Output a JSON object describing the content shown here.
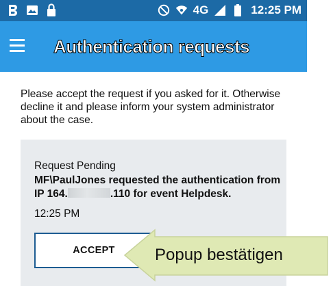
{
  "status_bar": {
    "network_label": "4G",
    "time": "12:25 PM"
  },
  "app_bar": {
    "title": "Authentication requests"
  },
  "intro_text": "Please accept the request if you asked for it. Otherwise decline it and please inform your system administrator about the case.",
  "request_card": {
    "title": "Request Pending",
    "message_before_ip": "MF\\PaulJones requested the authentication from IP 164.",
    "message_after_ip": ".110 for event Helpdesk.",
    "time": "12:25 PM",
    "accept_label": "ACCEPT"
  },
  "callout": {
    "text": "Popup bestätigen",
    "color": "#dfe9b4"
  },
  "colors": {
    "status_bar": "#1c6aa6",
    "app_bar": "#2e9ae4",
    "card_bg": "#e8ebee",
    "accept_border": "#1d5c92"
  }
}
